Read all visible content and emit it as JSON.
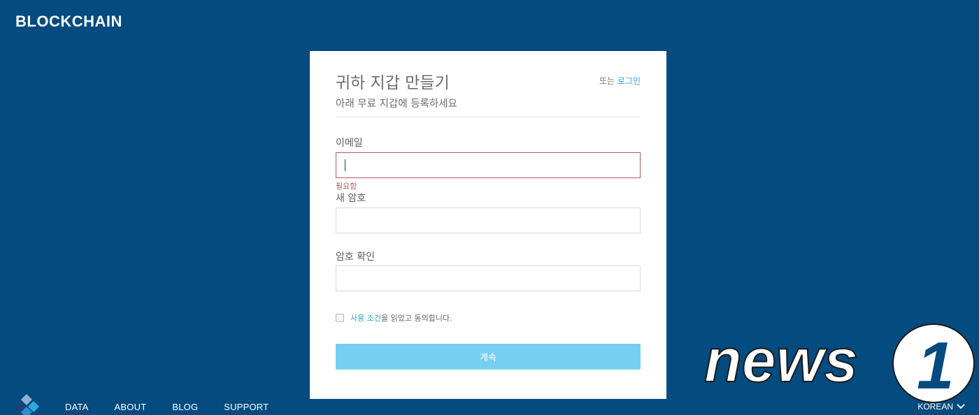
{
  "brand": {
    "name": "BLOCKCHAIN"
  },
  "form": {
    "title": "귀하 지갑 만들기",
    "or_text": "또는",
    "login_link": "로그인",
    "subtitle": "아래 무료 지갑에 등록하세요",
    "email": {
      "label": "이메일",
      "value": "",
      "error": "필요함"
    },
    "password": {
      "label": "새 암호",
      "value": ""
    },
    "confirm": {
      "label": "암호 확인",
      "value": ""
    },
    "terms": {
      "link": "사용 조건",
      "text": "을 읽었고 동의합니다."
    },
    "continue_label": "계속"
  },
  "footer": {
    "logo_icon": "blockchain-logo-icon",
    "nav": [
      "DATA",
      "ABOUT",
      "BLOG",
      "SUPPORT"
    ],
    "language": "KOREAN",
    "language_icon": "chevron-down-icon"
  },
  "watermark": {
    "text": "news",
    "digit": "1"
  },
  "colors": {
    "background": "#044b7f",
    "link": "#2ca2d8",
    "error": "#b05b5b",
    "button": "#76cfee"
  }
}
